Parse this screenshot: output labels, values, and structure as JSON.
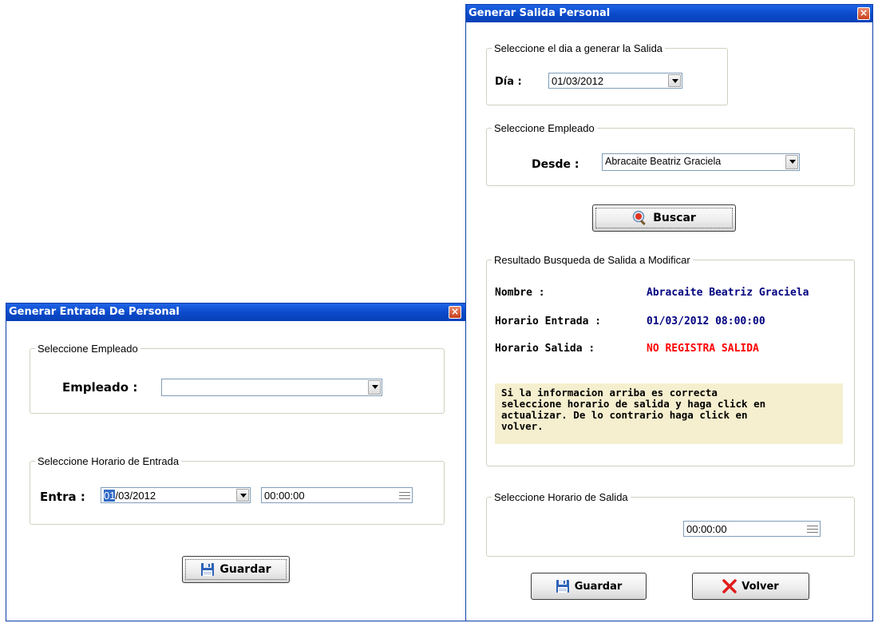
{
  "colors": {
    "title_bar": "#0a49c9",
    "result_value": "#000080",
    "no_salida": "#ff0000",
    "info_background": "#f5efcf"
  },
  "entrada_window": {
    "title": "Generar Entrada De Personal",
    "close_icon": "close-icon",
    "empleado_group": {
      "legend": "Seleccione Empleado",
      "label": "Empleado :",
      "value": ""
    },
    "horario_group": {
      "legend": "Seleccione Horario de Entrada",
      "label": "Entra :",
      "date_selected_part": "01",
      "date_rest": "/03/2012",
      "time": "00:00:00"
    },
    "save_button": {
      "label": "Guardar",
      "icon": "save-icon"
    }
  },
  "salida_window": {
    "title": "Generar Salida Personal",
    "close_icon": "close-icon",
    "dia_group": {
      "legend": "Seleccione el dia a generar la Salida",
      "label": "Día :",
      "value": "01/03/2012"
    },
    "empleado_group": {
      "legend": "Seleccione Empleado",
      "label": "Desde :",
      "value": "Abracaite Beatriz Graciela"
    },
    "search_button": {
      "label": "Buscar",
      "icon": "search-icon"
    },
    "result_group": {
      "legend": "Resultado Busqueda de Salida a Modificar",
      "nombre_label": "Nombre :",
      "nombre_value": "Abracaite Beatriz Graciela",
      "entrada_label": "Horario Entrada :",
      "entrada_value": "01/03/2012 08:00:00",
      "salida_label": "Horario Salida :",
      "salida_value": "NO REGISTRA SALIDA",
      "info_lines": [
        "Si la informacion arriba es correcta",
        "seleccione horario de salida y haga click en",
        "actualizar. De lo contrario haga click en",
        "volver."
      ]
    },
    "horario_group": {
      "legend": "Seleccione Horario de Salida",
      "time": "00:00:00"
    },
    "save_button": {
      "label": "Guardar",
      "icon": "save-icon"
    },
    "back_button": {
      "label": "Volver",
      "icon": "x-icon"
    }
  }
}
